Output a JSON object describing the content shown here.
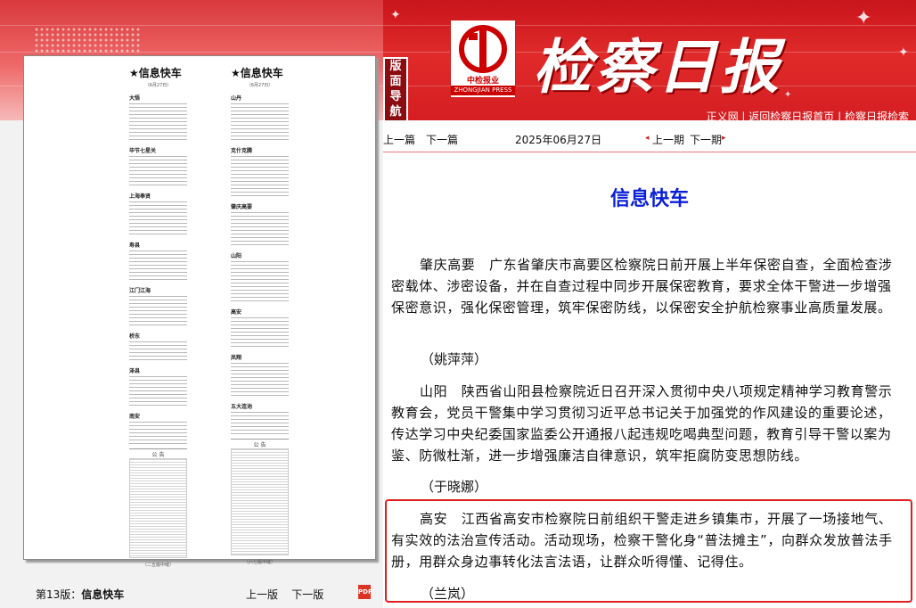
{
  "header": {
    "brand": "检察日报",
    "logo_cn": "中检报业",
    "logo_en": "ZHONGJIAN PRESS",
    "nav_badge": "版面导航",
    "top_links": [
      "正义网",
      "返回检察日报首页",
      "检察日报检索"
    ]
  },
  "thumbnail": {
    "left_column": {
      "title": "★信息快车",
      "date": "（6月27日）",
      "items": [
        "大悟",
        "毕节七星关",
        "上海奉贤",
        "寿县",
        "江门江海",
        "桥东",
        "泽县",
        "南安"
      ],
      "notice": "公 告",
      "foot": "（二五版中缝）"
    },
    "right_column": {
      "title": "★信息快车",
      "date": "（6月27日）",
      "items": [
        "山丹",
        "克什克腾",
        "肇庆高要",
        "山阳",
        "高安",
        "凤翔",
        "五大连池"
      ],
      "notice": "公 告",
      "foot": "（六七版中缝）"
    }
  },
  "page_pager": {
    "page_label": "第13版：",
    "page_name": "信息快车",
    "prev": "上一版",
    "next": "下一版",
    "pdf_icon": "pdf-icon"
  },
  "article_nav": {
    "prev": "上一篇",
    "next": "下一篇",
    "date": "2025年06月27日",
    "prev_issue": "上一期",
    "next_issue": "下一期"
  },
  "article": {
    "title": "信息快车",
    "paragraphs": [
      {
        "text": "肇庆高要　广东省肇庆市高要区检察院日前开展上半年保密自查，全面检查涉密载体、涉密设备，并在自查过程中同步开展保密教育，要求全体干警进一步增强保密意识，强化保密管理，筑牢保密防线，以保密安全护航检察事业高质量发展。",
        "author": "（姚萍萍）"
      },
      {
        "text": "山阳　陕西省山阳县检察院近日召开深入贯彻中央八项规定精神学习教育警示教育会，党员干警集中学习贯彻习近平总书记关于加强党的作风建设的重要论述，传达学习中央纪委国家监委公开通报八起违规吃喝典型问题，教育引导干警以案为鉴、防微杜渐，进一步增强廉洁自律意识，筑牢拒腐防变思想防线。",
        "author": "（于晓娜）"
      },
      {
        "text": "高安　江西省高安市检察院日前组织干警走进乡镇集市，开展了一场接地气、有实效的法治宣传活动。活动现场，检察干警化身“普法摊主”，向群众发放普法手册，用群众身边事转化法言法语，让群众听得懂、记得住。",
        "author": "（兰岚）"
      }
    ]
  },
  "colors": {
    "accent": "#d41e22",
    "title_blue": "#0a1fd6",
    "highlight": "#e02020"
  }
}
